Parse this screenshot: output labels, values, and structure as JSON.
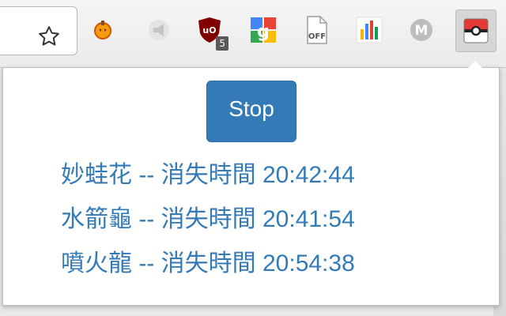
{
  "toolbar": {
    "extensions": [
      {
        "icon": "pumpkin-extension-icon"
      },
      {
        "icon": "megaphone-extension-icon"
      },
      {
        "icon": "ublock-origin-icon",
        "badge": "5"
      },
      {
        "icon": "google-extension-icon"
      },
      {
        "icon": "off-extension-icon",
        "label": "OFF"
      },
      {
        "icon": "chart-extension-icon"
      },
      {
        "icon": "m-extension-icon",
        "label": "M"
      },
      {
        "icon": "pokeball-extension-icon"
      }
    ]
  },
  "popup": {
    "stop_label": "Stop",
    "items": [
      {
        "text": "妙蛙花 -- 消失時間 20:42:44"
      },
      {
        "text": "水箭龜 -- 消失時間 20:41:54"
      },
      {
        "text": "噴火龍 -- 消失時間 20:54:38"
      }
    ]
  },
  "colors": {
    "accent": "#337ab7",
    "link": "#337ab7"
  }
}
